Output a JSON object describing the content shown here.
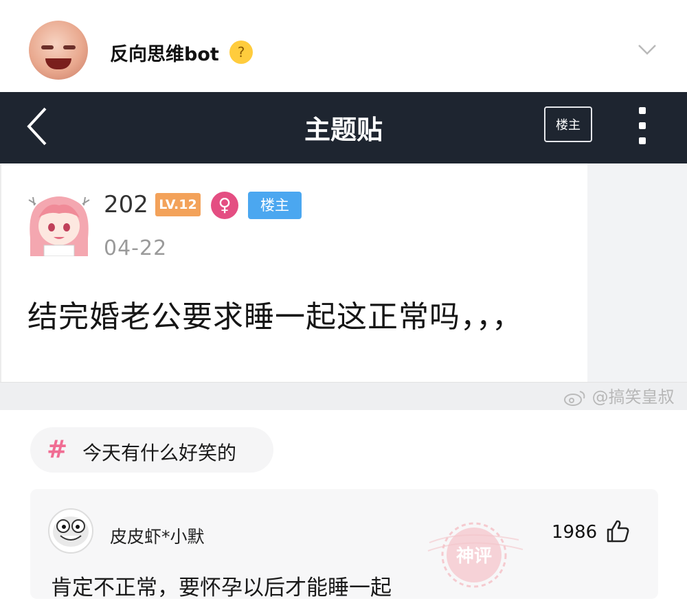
{
  "header": {
    "author_name": "反向思维bot",
    "author_avatar_icon": "user-avatar-icon",
    "emoji_icon": "thinking-face-icon",
    "menu_icon": "chevron-down-icon"
  },
  "navbar": {
    "back_icon": "chevron-left-icon",
    "title": "主题贴",
    "owner_only_label": "楼主",
    "more_icon": "more-vertical-icon",
    "background": "#1e2530"
  },
  "post": {
    "username": "202",
    "level_badge": "LV.12",
    "gender_symbol": "♀",
    "owner_badge": "楼主",
    "date": "04-22",
    "text": "结完婚老公要求睡一起这正常吗，，，"
  },
  "watermark": "@搞笑皇叔",
  "topic": {
    "hash": "#",
    "label": "今天有什么好笑的"
  },
  "comment": {
    "username": "皮皮虾*小默",
    "likes": "1986",
    "stamp_text": "神评",
    "text": "肯定不正常，要怀孕以后才能睡一起"
  },
  "colors": {
    "level_badge": "#f3a25a",
    "gender_badge": "#e44e82",
    "owner_badge": "#4ba7f0",
    "topic_hash": "#f06d93",
    "stamp": "#f3b6bd"
  }
}
